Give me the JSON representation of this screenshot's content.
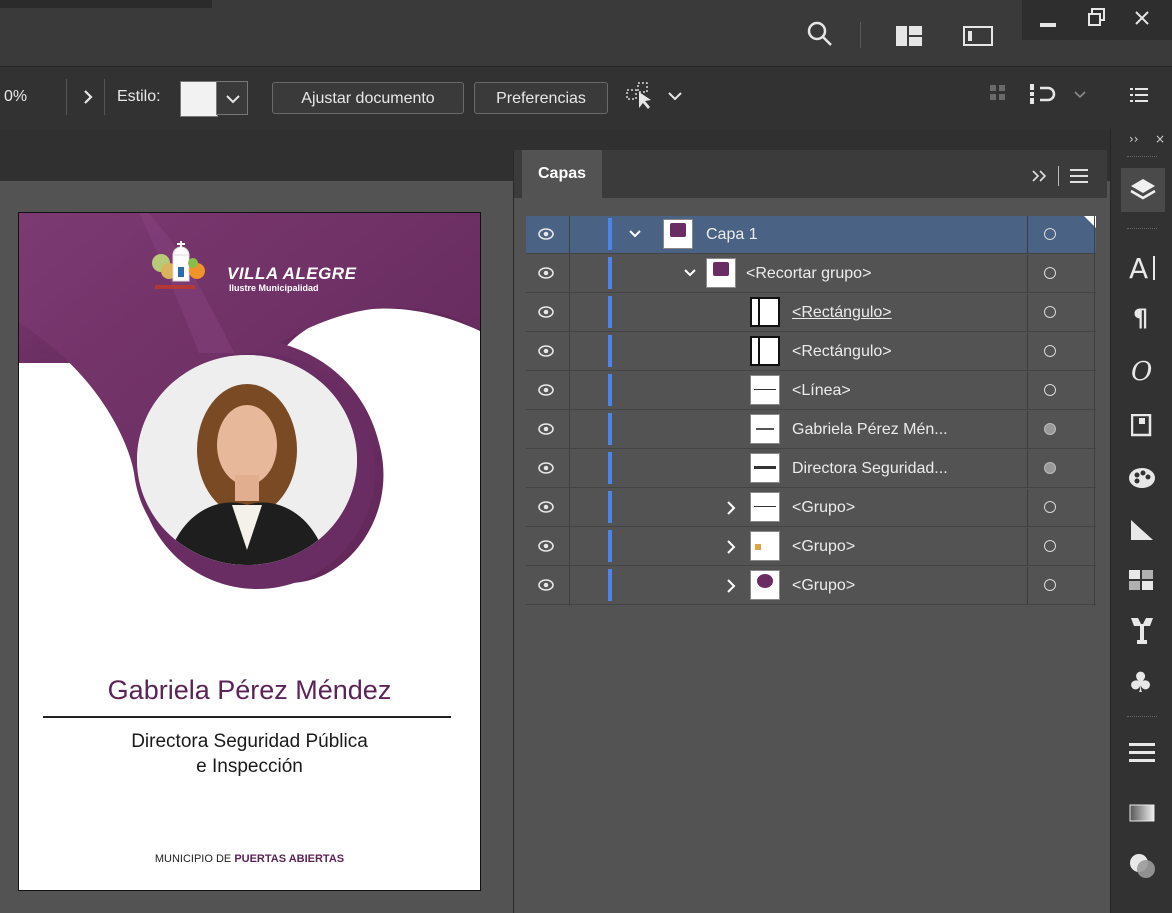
{
  "toolbar": {
    "zoom_value": "0%",
    "estilo_label": "Estilo:",
    "ajustar_label": "Ajustar documento",
    "preferencias_label": "Preferencias"
  },
  "layers_panel": {
    "tab_label": "Capas",
    "rows": [
      {
        "name": "Capa 1",
        "selected": true
      },
      {
        "name": "<Recortar grupo>"
      },
      {
        "name": "<Rectángulo>"
      },
      {
        "name": "<Rectángulo>"
      },
      {
        "name": "<Línea>"
      },
      {
        "name": "Gabriela Pérez Mén..."
      },
      {
        "name": "Directora Seguridad..."
      },
      {
        "name": "<Grupo>"
      },
      {
        "name": "<Grupo>"
      },
      {
        "name": "<Grupo>"
      }
    ]
  },
  "artboard": {
    "logo_title": "VILLA ALEGRE",
    "logo_subtitle": "Ilustre Municipalidad",
    "person_name": "Gabriela Pérez Méndez",
    "role_line1": "Directora Seguridad Pública",
    "role_line2": "e Inspección",
    "footer_prefix": "MUNICIPIO DE ",
    "footer_bold": "PUERTAS ABIERTAS"
  },
  "colors": {
    "brand_purple": "#6a2d63",
    "selection_blue": "#4a6385",
    "layer_color_bar": "#4a86e8"
  }
}
